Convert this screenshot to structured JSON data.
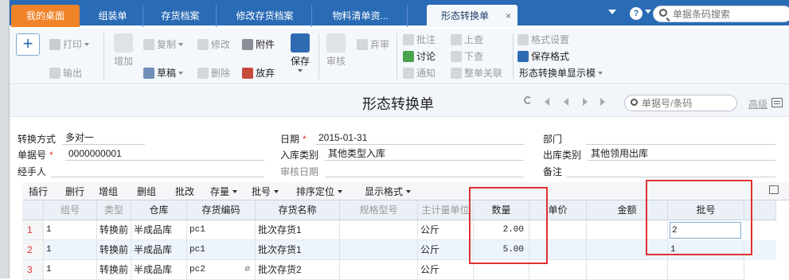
{
  "tabs": [
    {
      "label": "我的桌面"
    },
    {
      "label": "组装单"
    },
    {
      "label": "存货档案"
    },
    {
      "label": "修改存货档案"
    },
    {
      "label": "物料清单资..."
    },
    {
      "label": "形态转换单",
      "close": "×"
    }
  ],
  "topbar": {
    "help": "?",
    "search_placeholder": "单据条码搜索"
  },
  "toolbar": {
    "add": "+",
    "print": "打印",
    "export": "输出",
    "add_row": "增加",
    "copy": "复制",
    "draft": "草稿",
    "edit": "修改",
    "delete": "删除",
    "attach": "附件",
    "discard": "放弃",
    "save": "保存",
    "audit": "审核",
    "abandon": "弃审",
    "approve": "批注",
    "discuss": "讨论",
    "notify": "通知",
    "prev": "上查",
    "next": "下查",
    "whole": "整单关联",
    "format_set": "格式设置",
    "save_format": "保存格式",
    "display_template": "形态转换单显示模"
  },
  "title": {
    "page_title": "形态转换单",
    "search_placeholder": "单据号/条码",
    "advanced": "高级"
  },
  "form": {
    "convert_mode_label": "转换方式",
    "convert_mode": "多对一",
    "date_label": "日期",
    "date": "2015-01-31",
    "dept_label": "部门",
    "dept": "",
    "doc_no_label": "单据号",
    "doc_no": "0000000001",
    "in_type_label": "入库类别",
    "in_type": "其他类型入库",
    "out_type_label": "出库类别",
    "out_type": "其他领用出库",
    "handler_label": "经手人",
    "handler": "",
    "audit_date_label": "审核日期",
    "audit_date": "",
    "remark_label": "备注",
    "remark": ""
  },
  "grid_toolbar": {
    "insert_row": "插行",
    "delete_row": "删行",
    "add_group": "增组",
    "delete_group": "删组",
    "batch_edit": "批改",
    "stock": "存量",
    "batch": "批号",
    "sort": "排序定位",
    "display_format": "显示格式"
  },
  "grid": {
    "headers": [
      "组号",
      "类型",
      "仓库",
      "存货编码",
      "存货名称",
      "规格型号",
      "主计量单位",
      "数量",
      "单价",
      "金额",
      "批号"
    ],
    "rows": [
      {
        "idx": "1",
        "group": "1",
        "type": "转换前",
        "warehouse": "半成品库",
        "code": "pc1",
        "name": "批次存货1",
        "spec": "",
        "unit": "公斤",
        "qty": "2.00",
        "price": "",
        "amount": "",
        "batch": "2"
      },
      {
        "idx": "2",
        "group": "1",
        "type": "转换前",
        "warehouse": "半成品库",
        "code": "pc1",
        "name": "批次存货1",
        "spec": "",
        "unit": "公斤",
        "qty": "5.00",
        "price": "",
        "amount": "",
        "batch": "1"
      },
      {
        "idx": "3",
        "group": "1",
        "type": "转换前",
        "warehouse": "半成品库",
        "code": "pc2",
        "name": "批次存货2",
        "spec": "",
        "unit": "公斤",
        "qty": "",
        "price": "",
        "amount": "",
        "batch": ""
      }
    ]
  },
  "colors": {
    "topbar": "#2a6bb5",
    "home_tab": "#f08228",
    "highlight_box": "#e03030",
    "required": "#dd3333"
  }
}
